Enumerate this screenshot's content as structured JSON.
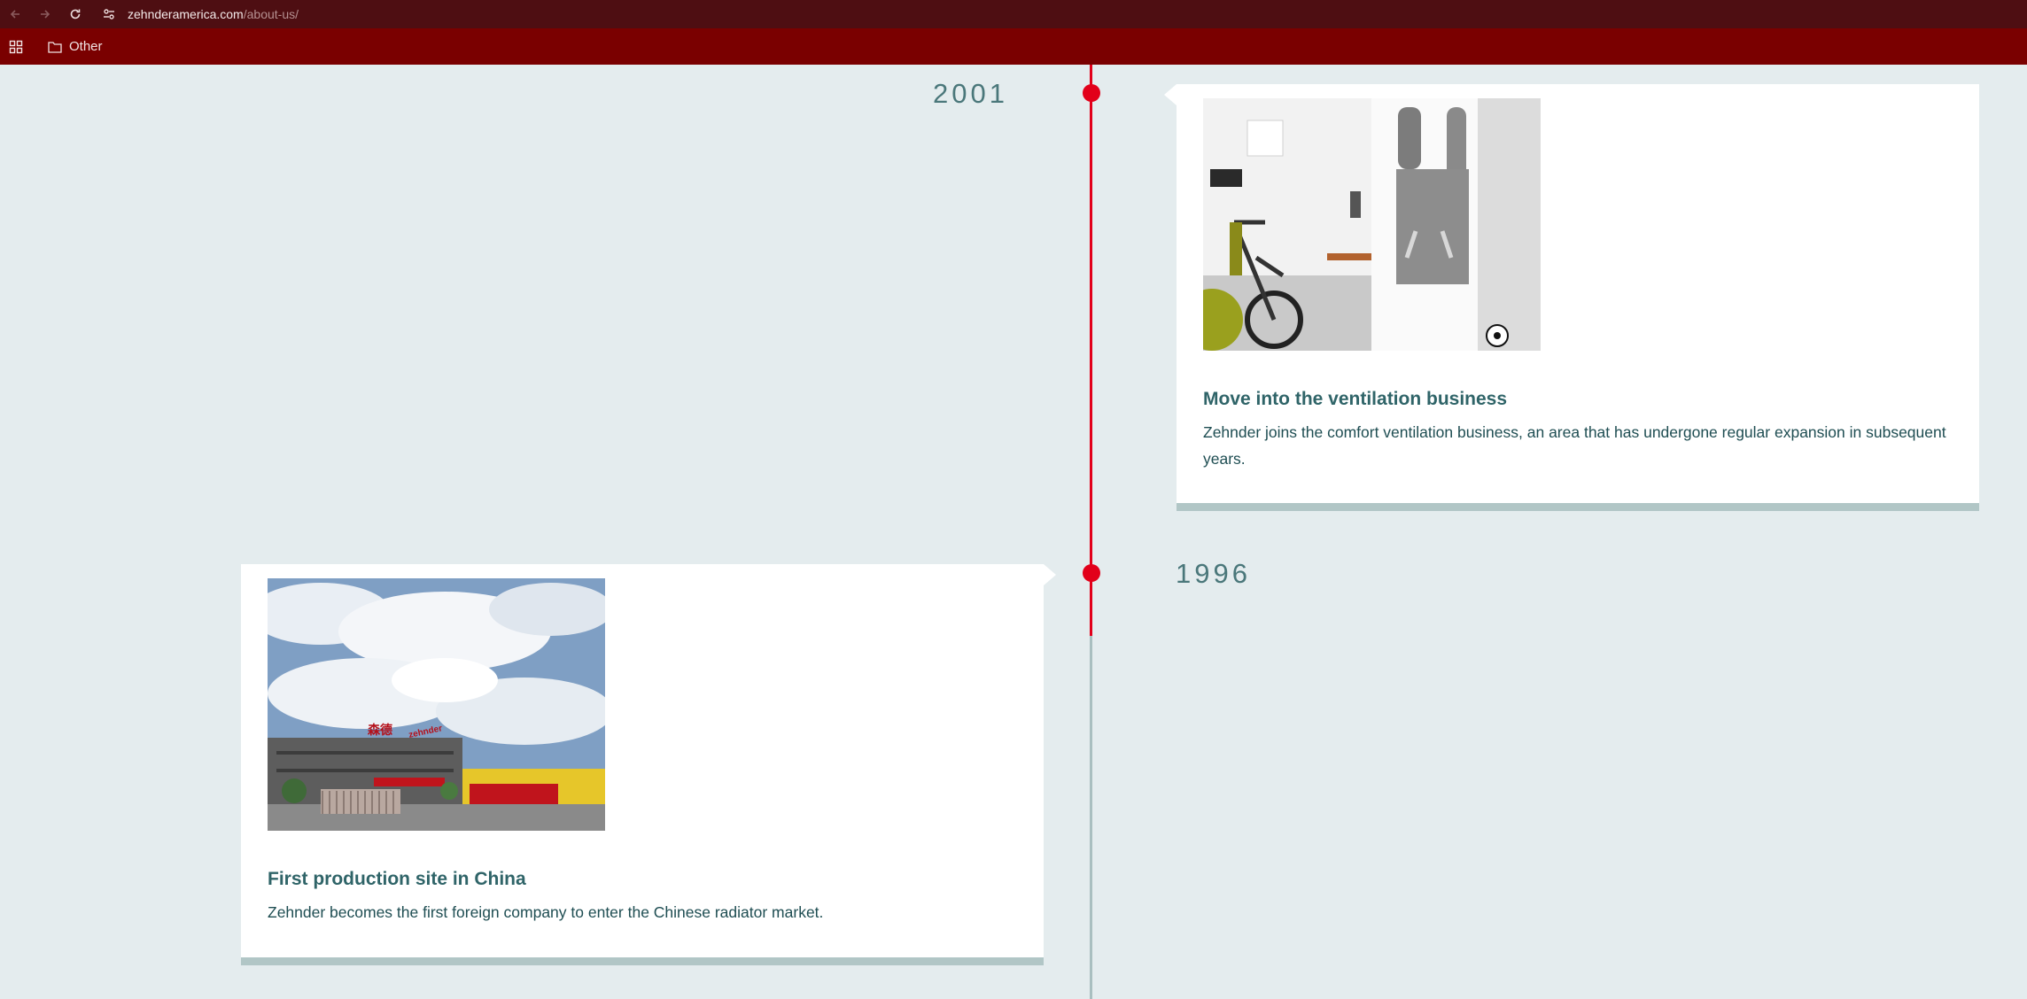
{
  "browser": {
    "url_host": "zehnderamerica.com",
    "url_path": "/about-us/",
    "bookmark_folder": "Other"
  },
  "icons": {
    "back": "arrow-left-icon",
    "forward": "arrow-right-icon",
    "reload": "reload-icon",
    "site_settings": "tune-icon",
    "apps": "apps-grid-icon",
    "folder": "folder-icon"
  },
  "colors": {
    "chrome_dark": "#4e0e12",
    "bookmarks_bar": "#7a0000",
    "timeline_red": "#e2001a",
    "timeline_grey": "#a9bfc0",
    "page_bg": "#e4ecee",
    "heading": "#2f6468"
  },
  "timeline": [
    {
      "year": "2001",
      "title": "Move into the ventilation business",
      "description": "Zehnder joins the comfort ventilation business, an area that has undergone regular expansion in subsequent years."
    },
    {
      "year": "1996",
      "title": "First production site in China",
      "description": "Zehnder becomes the first foreign company to enter the Chinese radiator market."
    }
  ],
  "factory_sign": {
    "chinese_text": "森德",
    "brand_text": "zehnder"
  }
}
